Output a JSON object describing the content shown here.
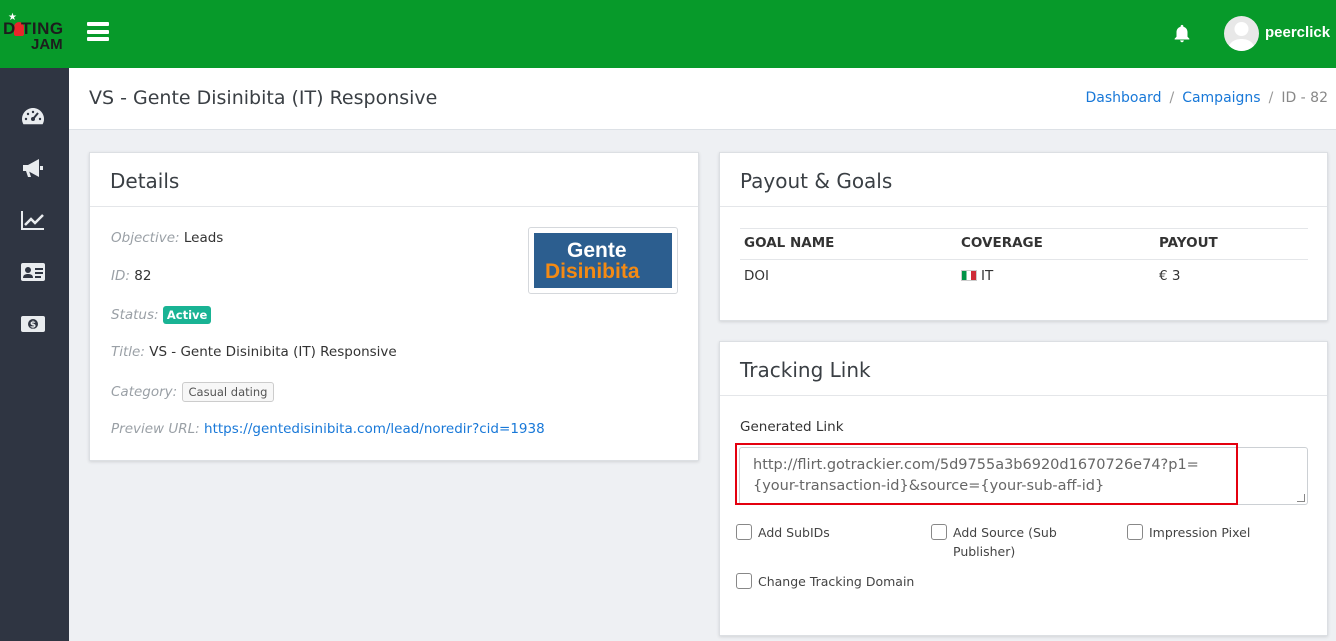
{
  "brand": {
    "logo_line1": "D TING",
    "logo_line2": "JAM"
  },
  "topbar": {
    "username": "peerclick",
    "accent": "#079a2a"
  },
  "sidebar": {
    "items": [
      {
        "name": "dashboard",
        "icon": "speedometer-icon"
      },
      {
        "name": "campaigns",
        "icon": "megaphone-icon"
      },
      {
        "name": "statistics",
        "icon": "chart-line-icon"
      },
      {
        "name": "profile",
        "icon": "id-card-icon"
      },
      {
        "name": "payments",
        "icon": "money-icon"
      }
    ]
  },
  "header": {
    "title": "VS - Gente Disinibita (IT) Responsive",
    "breadcrumb": [
      "Dashboard",
      "Campaigns",
      "ID - 82"
    ]
  },
  "details": {
    "title": "Details",
    "objective_label": "Objective:",
    "objective": "Leads",
    "id_label": "ID:",
    "id": "82",
    "status_label": "Status:",
    "status": "Active",
    "title_label": "Title:",
    "title_value": "VS - Gente Disinibita (IT) Responsive",
    "category_label": "Category:",
    "category": "Casual dating",
    "preview_label": "Preview URL:",
    "preview_url": "https://gentedisinibita.com/lead/noredir?cid=1938",
    "thumb_line1": "Gente",
    "thumb_line2": "Disinibita"
  },
  "payout": {
    "title": "Payout & Goals",
    "columns": [
      "GOAL NAME",
      "COVERAGE",
      "PAYOUT"
    ],
    "rows": [
      {
        "goal": "DOI",
        "coverage": "IT",
        "payout": "€ 3"
      }
    ]
  },
  "tracking": {
    "title": "Tracking Link",
    "generated_label": "Generated Link",
    "generated_link": "http://flirt.gotrackier.com/5d9755a3b6920d1670726e74?p1={your-transaction-id}&source={your-sub-aff-id}",
    "options": [
      "Add SubIDs",
      "Add Source (Sub Publisher)",
      "Impression Pixel",
      "Change Tracking Domain"
    ]
  }
}
